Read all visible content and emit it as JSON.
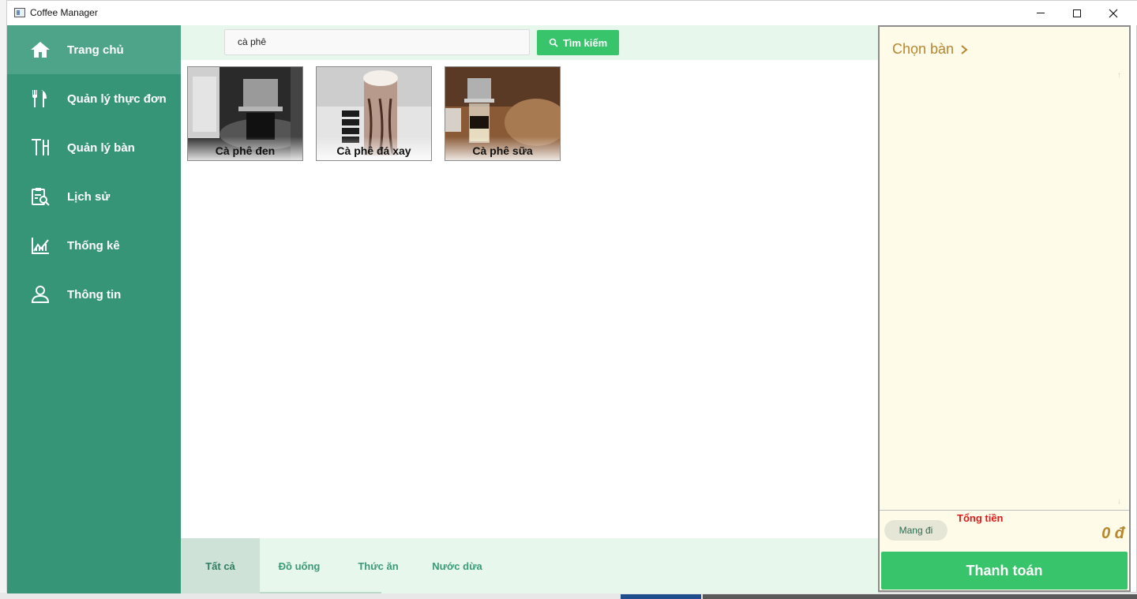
{
  "window": {
    "title": "Coffee Manager"
  },
  "sidebar": {
    "items": [
      {
        "label": "Trang chủ",
        "icon": "home-icon",
        "active": true
      },
      {
        "label": "Quản lý thực đơn",
        "icon": "fork-knife-icon",
        "active": false
      },
      {
        "label": "Quản lý bàn",
        "icon": "table-icon",
        "active": false
      },
      {
        "label": "Lịch sử",
        "icon": "history-clipboard-icon",
        "active": false
      },
      {
        "label": "Thống kê",
        "icon": "chart-icon",
        "active": false
      },
      {
        "label": "Thông tin",
        "icon": "user-icon",
        "active": false
      }
    ]
  },
  "search": {
    "value": "cà phê",
    "button_label": "Tìm kiếm"
  },
  "products": [
    {
      "name": "Cà phê đen"
    },
    {
      "name": "Cà phê đá xay"
    },
    {
      "name": "Cà phê sữa"
    }
  ],
  "tabs": [
    {
      "label": "Tất cả",
      "active": true
    },
    {
      "label": "Đồ uống",
      "active": false
    },
    {
      "label": "Thức ăn",
      "active": false
    },
    {
      "label": "Nước dừa",
      "active": false
    }
  ],
  "order": {
    "choose_table_label": "Chọn bàn",
    "takeaway_label": "Mang đi",
    "total_label": "Tổng tiền",
    "total_value": "0 đ",
    "pay_label": "Thanh toán"
  },
  "colors": {
    "sidebar": "#369576",
    "sidebar_active": "#4ea488",
    "accent_green": "#37c46a",
    "panel_bg": "#fefbe8",
    "total_red": "#e01a1a",
    "gold": "#b5862f"
  }
}
